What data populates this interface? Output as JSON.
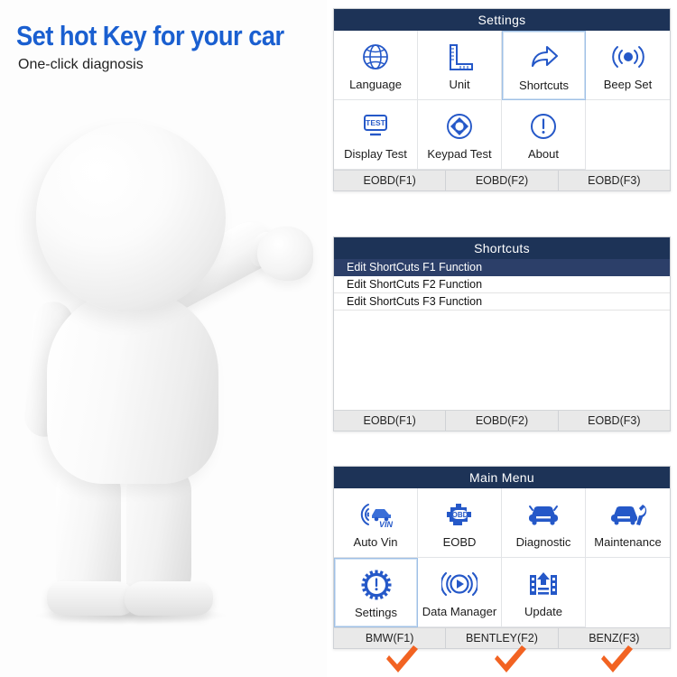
{
  "promo": {
    "headline": "Set hot Key for your car",
    "subheadline": "One-click diagnosis",
    "headline_color": "#1a5fd0",
    "mascot_alt": "white-3d-mascot-waving"
  },
  "settings_panel": {
    "title": "Settings",
    "items": [
      {
        "label": "Language",
        "icon": "globe-icon",
        "selected": false
      },
      {
        "label": "Unit",
        "icon": "ruler-icon",
        "selected": false
      },
      {
        "label": "Shortcuts",
        "icon": "share-arrow-icon",
        "selected": true
      },
      {
        "label": "Beep Set",
        "icon": "beep-signal-icon",
        "selected": false
      },
      {
        "label": "Display Test",
        "icon": "monitor-test-icon",
        "selected": false
      },
      {
        "label": "Keypad Test",
        "icon": "keypad-dpad-icon",
        "selected": false
      },
      {
        "label": "About",
        "icon": "exclamation-circle-icon",
        "selected": false
      }
    ],
    "fkeys": [
      "EOBD(F1)",
      "EOBD(F2)",
      "EOBD(F3)"
    ]
  },
  "shortcuts_panel": {
    "title": "Shortcuts",
    "rows": [
      {
        "label": "Edit ShortCuts F1 Function",
        "selected": true
      },
      {
        "label": "Edit ShortCuts F2 Function",
        "selected": false
      },
      {
        "label": "Edit ShortCuts F3 Function",
        "selected": false
      }
    ],
    "fkeys": [
      "EOBD(F1)",
      "EOBD(F2)",
      "EOBD(F3)"
    ]
  },
  "main_menu_panel": {
    "title": "Main Menu",
    "items": [
      {
        "label": "Auto Vin",
        "icon": "auto-vin-car-icon",
        "selected": false
      },
      {
        "label": "EOBD",
        "icon": "obd-engine-icon",
        "selected": false
      },
      {
        "label": "Diagnostic",
        "icon": "car-front-icon",
        "selected": false
      },
      {
        "label": "Maintenance",
        "icon": "car-wrench-icon",
        "selected": false
      },
      {
        "label": "Settings",
        "icon": "gear-exclaim-icon",
        "selected": true
      },
      {
        "label": "Data Manager",
        "icon": "play-circle-icon",
        "selected": false
      },
      {
        "label": "Update",
        "icon": "upload-film-icon",
        "selected": false
      }
    ],
    "fkeys": [
      "BMW(F1)",
      "BENTLEY(F2)",
      "BENZ(F3)"
    ]
  },
  "annotations": {
    "checkmarks": [
      {
        "name": "checkmark-bmw",
        "color": "#f26322"
      },
      {
        "name": "checkmark-bentley",
        "color": "#f26322"
      },
      {
        "name": "checkmark-benz",
        "color": "#f26322"
      }
    ]
  },
  "theme": {
    "header_navy": "#1d3357",
    "icon_blue": "#2558c8",
    "highlight_navy": "#2c3f69",
    "fkey_bg": "#e9e9e9",
    "accent_orange": "#f26322"
  }
}
